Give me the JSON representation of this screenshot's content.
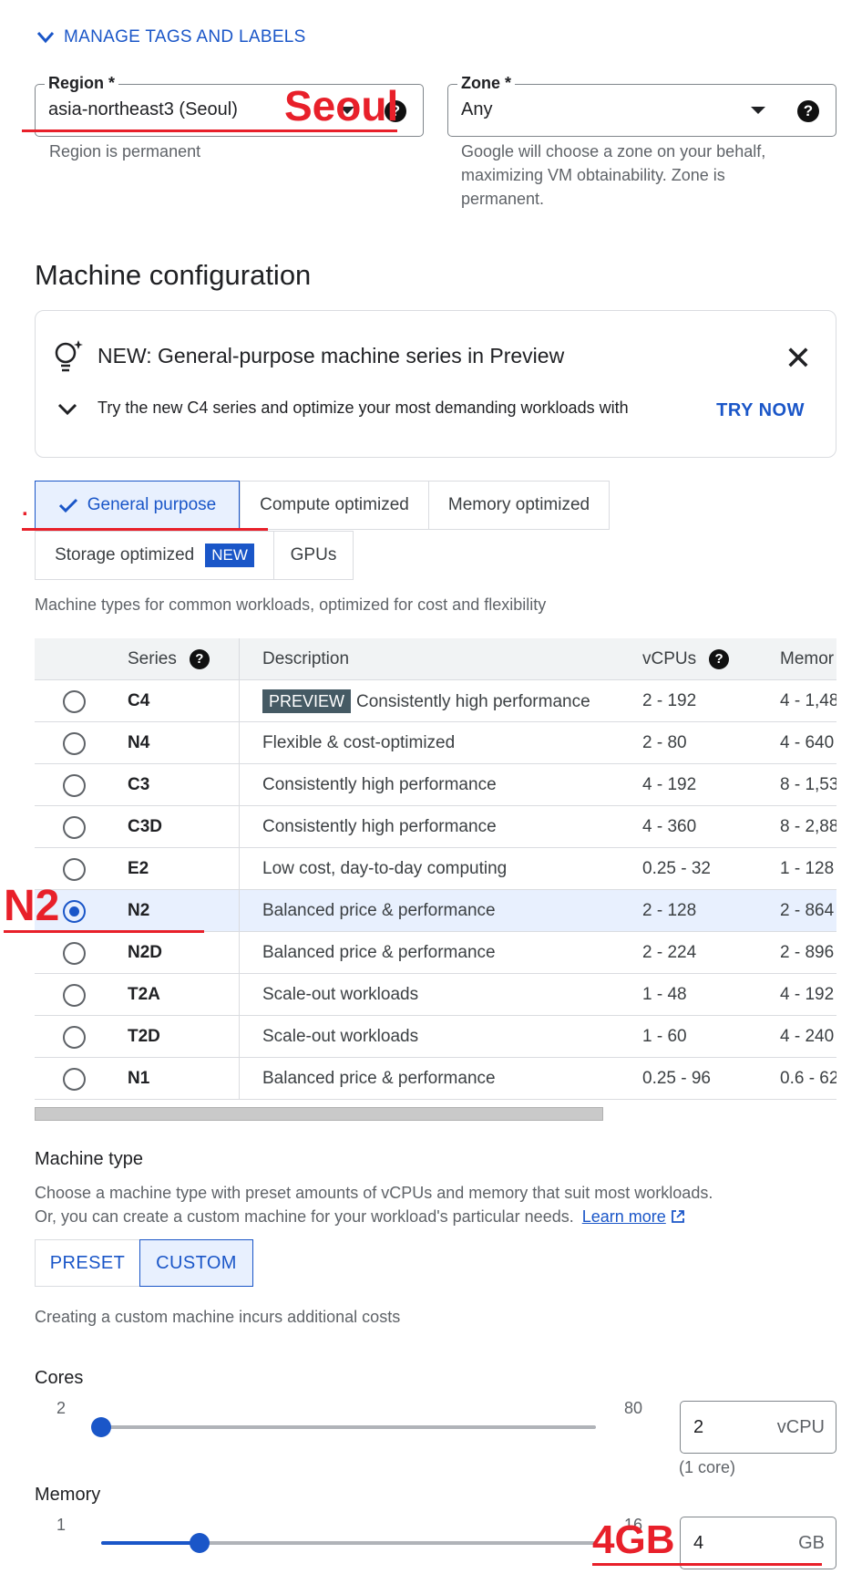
{
  "manage_tags": {
    "label": "MANAGE TAGS AND LABELS"
  },
  "region": {
    "label": "Region *",
    "value": "asia-northeast3 (Seoul)",
    "hint": "Region is permanent",
    "annotation": "Seoul"
  },
  "zone": {
    "label": "Zone *",
    "value": "Any",
    "hint_lines": [
      "Google will choose a zone on your behalf,",
      "maximizing VM obtainability. Zone is",
      "permanent."
    ]
  },
  "machine_config": {
    "title": "Machine configuration"
  },
  "banner": {
    "title": "NEW: General-purpose machine series in Preview",
    "text": "Try the new C4 series and optimize your most demanding workloads with",
    "action": "TRY NOW",
    "close_glyph": "✕"
  },
  "tabs": {
    "general": "General purpose",
    "compute": "Compute optimized",
    "memory": "Memory optimized",
    "storage": "Storage optimized",
    "storage_badge": "NEW",
    "gpus": "GPUs",
    "selected": "General purpose"
  },
  "tab_description": "Machine types for common workloads, optimized for cost and flexibility",
  "table": {
    "headers": {
      "series": "Series",
      "description": "Description",
      "vcpus": "vCPUs",
      "memory": "Memor"
    },
    "preview_badge": "PREVIEW",
    "rows": [
      {
        "series": "C4",
        "description": "Consistently high performance",
        "vcpus": "2 - 192",
        "memory": "4 - 1,48",
        "selected": false
      },
      {
        "series": "N4",
        "description": "Flexible & cost-optimized",
        "vcpus": "2 - 80",
        "memory": "4 - 640",
        "selected": false
      },
      {
        "series": "C3",
        "description": "Consistently high performance",
        "vcpus": "4 - 192",
        "memory": "8 - 1,53",
        "selected": false
      },
      {
        "series": "C3D",
        "description": "Consistently high performance",
        "vcpus": "4 - 360",
        "memory": "8 - 2,88",
        "selected": false
      },
      {
        "series": "E2",
        "description": "Low cost, day-to-day computing",
        "vcpus": "0.25 - 32",
        "memory": "1 - 128",
        "selected": false
      },
      {
        "series": "N2",
        "description": "Balanced price & performance",
        "vcpus": "2 - 128",
        "memory": "2 - 864",
        "selected": true
      },
      {
        "series": "N2D",
        "description": "Balanced price & performance",
        "vcpus": "2 - 224",
        "memory": "2 - 896",
        "selected": false
      },
      {
        "series": "T2A",
        "description": "Scale-out workloads",
        "vcpus": "1 - 48",
        "memory": "4 - 192",
        "selected": false
      },
      {
        "series": "T2D",
        "description": "Scale-out workloads",
        "vcpus": "1 - 60",
        "memory": "4 - 240",
        "selected": false
      },
      {
        "series": "N1",
        "description": "Balanced price & performance",
        "vcpus": "0.25 - 96",
        "memory": "0.6 - 62",
        "selected": false
      }
    ],
    "annotation": "N2"
  },
  "machine_type": {
    "title": "Machine type",
    "line1": "Choose a machine type with preset amounts of vCPUs and memory that suit most workloads.",
    "line2": "Or, you can create a custom machine for your workload's particular needs.",
    "learn_more": "Learn more",
    "preset": "PRESET",
    "custom": "CUSTOM",
    "selected": "CUSTOM",
    "custom_note": "Creating a custom machine incurs additional costs"
  },
  "cores": {
    "title": "Cores",
    "min": "2",
    "max": "80",
    "value": "2",
    "unit": "vCPU",
    "note": "(1 core)",
    "level": 0
  },
  "memory": {
    "title": "Memory",
    "min": "1",
    "max": "16",
    "value": "4",
    "unit": "GB",
    "annotation": "4GB",
    "level": 0.2
  },
  "colors": {
    "accent": "#1a56c8",
    "annotation": "#e8202a",
    "selected_bg": "#e8f0fe"
  }
}
